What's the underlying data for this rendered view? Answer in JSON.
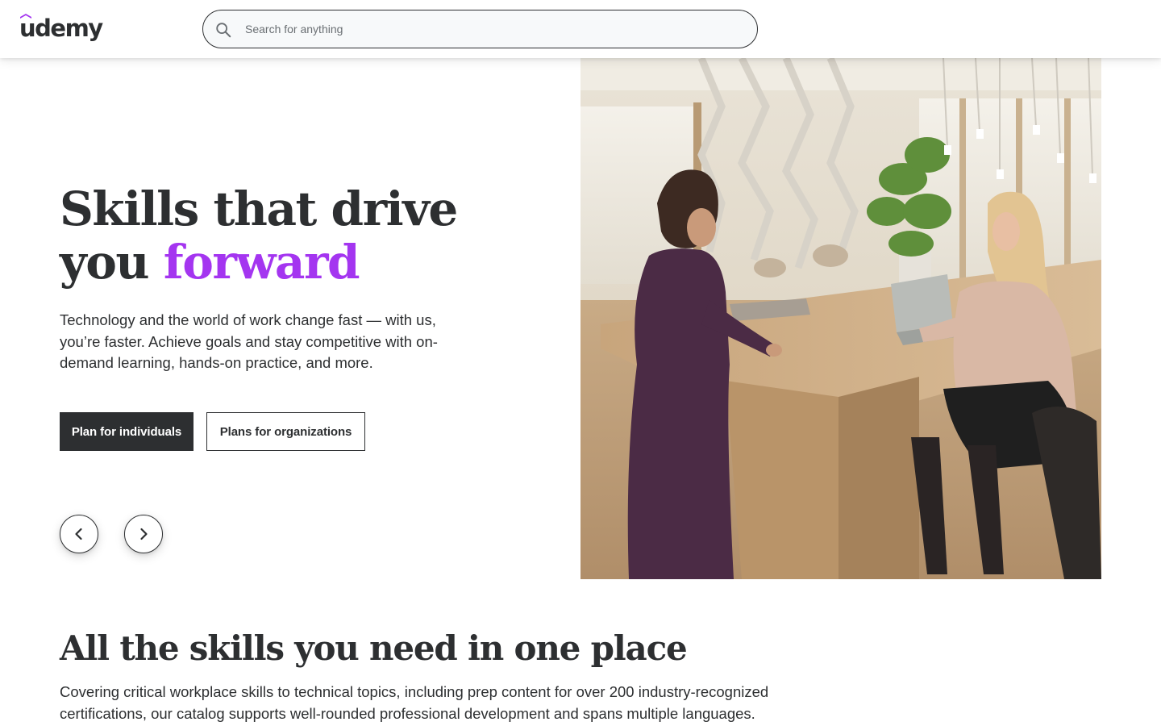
{
  "header": {
    "logo_text": "udemy",
    "search": {
      "placeholder": "Search for anything",
      "value": ""
    }
  },
  "hero": {
    "title_line1": "Skills that drive",
    "title_line2_start": "you",
    "title_accent": "forward",
    "description": "Technology and the world of work change fast — with us, you’re faster. Achieve goals and stay competitive with on-demand learning, hands-on practice, and more.",
    "primary_button": "Plan for individuals",
    "secondary_button": "Plans for organizations",
    "image_alt": "Two women talking at a wooden table in a modern office"
  },
  "carousel": {
    "prev_icon": "chevron-left-icon",
    "next_icon": "chevron-right-icon"
  },
  "section": {
    "title": "All the skills you need in one place",
    "description": "Covering critical workplace skills to technical topics, including prep content for over 200 industry-recognized certifications, our catalog supports well-rounded professional development and spans multiple languages."
  },
  "colors": {
    "accent": "#a435f0",
    "text": "#2d2f31",
    "primary_button_bg": "#2d2f31"
  }
}
